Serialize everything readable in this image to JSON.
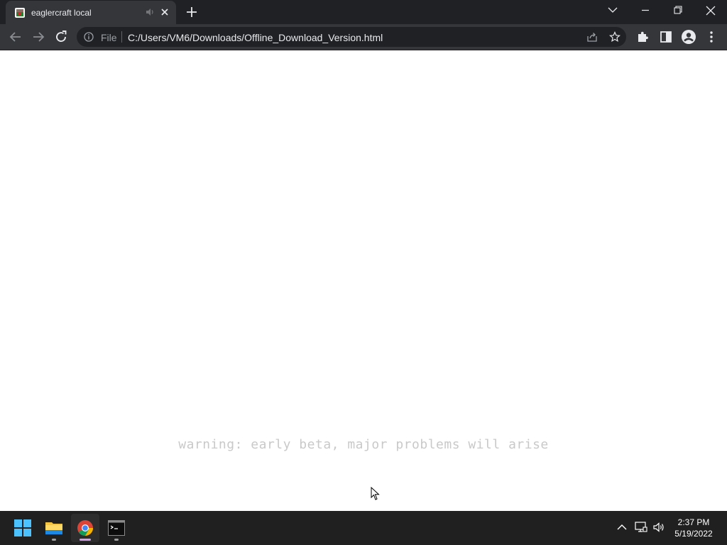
{
  "browser": {
    "tab": {
      "title": "eaglercraft local"
    },
    "omnibox": {
      "scheme_label": "File",
      "url": "C:/Users/VM6/Downloads/Offline_Download_Version.html"
    }
  },
  "page": {
    "warning_text": "warning: early beta, major problems will arise"
  },
  "taskbar": {
    "time": "2:37 PM",
    "date": "5/19/2022"
  },
  "icons": {
    "tab_favicon": "game-favicon-icon",
    "tab_audio": "audio-icon",
    "tab_close": "close-icon",
    "new_tab": "plus-icon",
    "window_controls": [
      "chevron-down-icon",
      "minimize-icon",
      "restore-icon",
      "close-icon"
    ],
    "nav": [
      "back-arrow-icon",
      "forward-arrow-icon",
      "reload-icon"
    ],
    "omnibox": [
      "info-icon",
      "share-icon",
      "star-icon"
    ],
    "toolbar_right": [
      "puzzle-icon",
      "side-panel-icon",
      "profile-icon",
      "more-vert-icon"
    ],
    "taskbar_apps": [
      "windows-start-icon",
      "file-explorer-icon",
      "chrome-icon",
      "terminal-icon"
    ],
    "tray": [
      "chevron-up-icon",
      "network-icon",
      "volume-icon"
    ]
  },
  "colors": {
    "titlebar": "#202124",
    "toolbar": "#35363a",
    "omnibox": "#202124",
    "taskbar": "#202020",
    "warning_text": "#c9c9c9"
  }
}
